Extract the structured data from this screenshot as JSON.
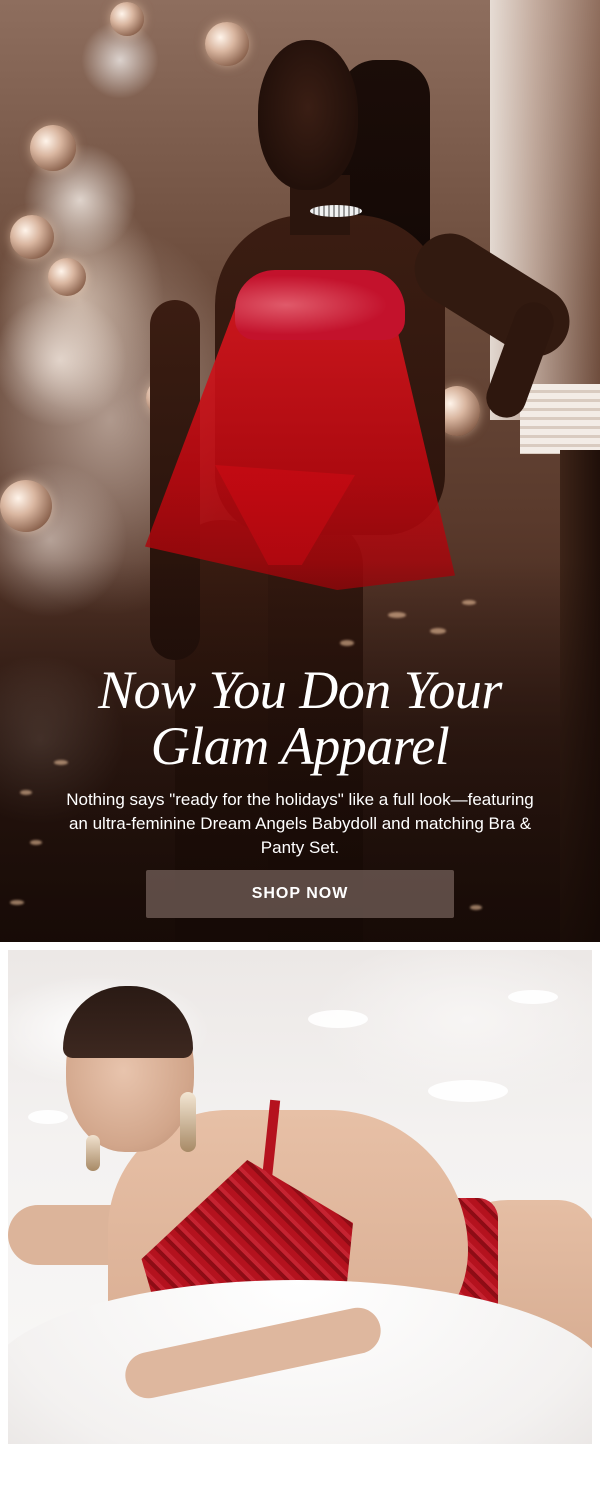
{
  "hero": {
    "title_line1": "Now You Don Your",
    "title_line2": "Glam Apparel",
    "body": "Nothing says \"ready for the holidays\" like a full look—featuring an ultra-feminine Dream Angels Babydoll and matching Bra & Panty Set.",
    "cta_label": "SHOP NOW"
  },
  "colors": {
    "cta_background": "#705c56",
    "text": "#ffffff",
    "lingerie_red": "#d4141e"
  }
}
